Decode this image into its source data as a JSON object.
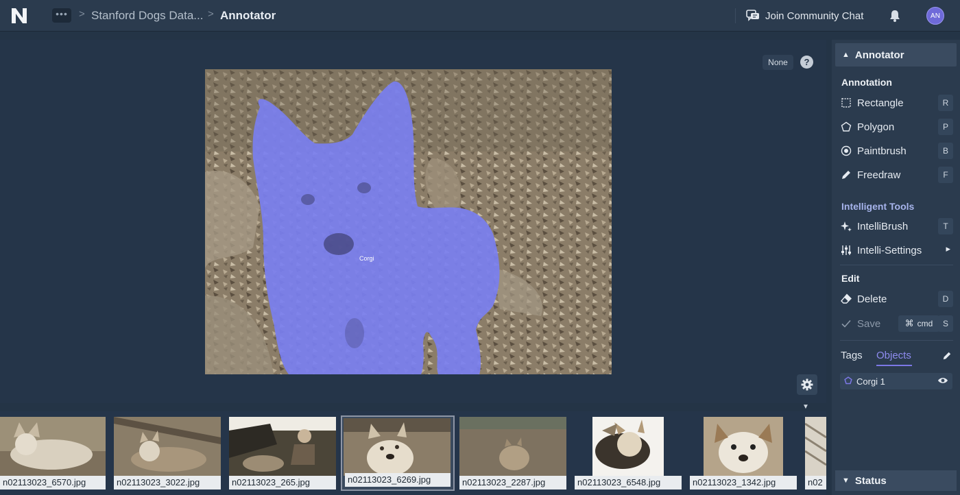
{
  "topbar": {
    "more_label": "•••",
    "breadcrumb_sep": ">",
    "dataset": "Stanford Dogs Data...",
    "current": "Annotator",
    "chat_link": "Join Community Chat",
    "avatar_initials": "AN"
  },
  "canvas": {
    "class_selector": "None",
    "help_label": "?",
    "annotation_label": "Corgi",
    "annotation_color": "#7a7ff0",
    "collapse_glyph": "▼"
  },
  "filmstrip": [
    {
      "filename": "n02113023_6570.jpg",
      "selected": false
    },
    {
      "filename": "n02113023_3022.jpg",
      "selected": false
    },
    {
      "filename": "n02113023_265.jpg",
      "selected": false
    },
    {
      "filename": "n02113023_6269.jpg",
      "selected": true
    },
    {
      "filename": "n02113023_2287.jpg",
      "selected": false
    },
    {
      "filename": "n02113023_6548.jpg",
      "selected": false
    },
    {
      "filename": "n02113023_1342.jpg",
      "selected": false
    },
    {
      "filename": "n02",
      "selected": false
    }
  ],
  "panel": {
    "header": "Annotator",
    "annotation_section": "Annotation",
    "tools": [
      {
        "label": "Rectangle",
        "key": "R",
        "icon": "rectangle-icon"
      },
      {
        "label": "Polygon",
        "key": "P",
        "icon": "polygon-icon"
      },
      {
        "label": "Paintbrush",
        "key": "B",
        "icon": "paintbrush-icon"
      },
      {
        "label": "Freedraw",
        "key": "F",
        "icon": "pencil-icon"
      }
    ],
    "intelligent_section": "Intelligent Tools",
    "intellibrush": {
      "label": "IntelliBrush",
      "key": "T"
    },
    "intelli_settings": {
      "label": "Intelli-Settings",
      "arrow": "▸"
    },
    "edit_section": "Edit",
    "delete": {
      "label": "Delete",
      "key": "D"
    },
    "save": {
      "label": "Save",
      "cmd": "cmd",
      "key": "S"
    },
    "tabs": {
      "tags": "Tags",
      "objects": "Objects"
    },
    "objects": [
      {
        "label": "Corgi 1"
      }
    ],
    "status": "Status"
  },
  "colors": {
    "accent": "#7c78e6",
    "background": "#243446",
    "panel": "#2b3b4e"
  }
}
